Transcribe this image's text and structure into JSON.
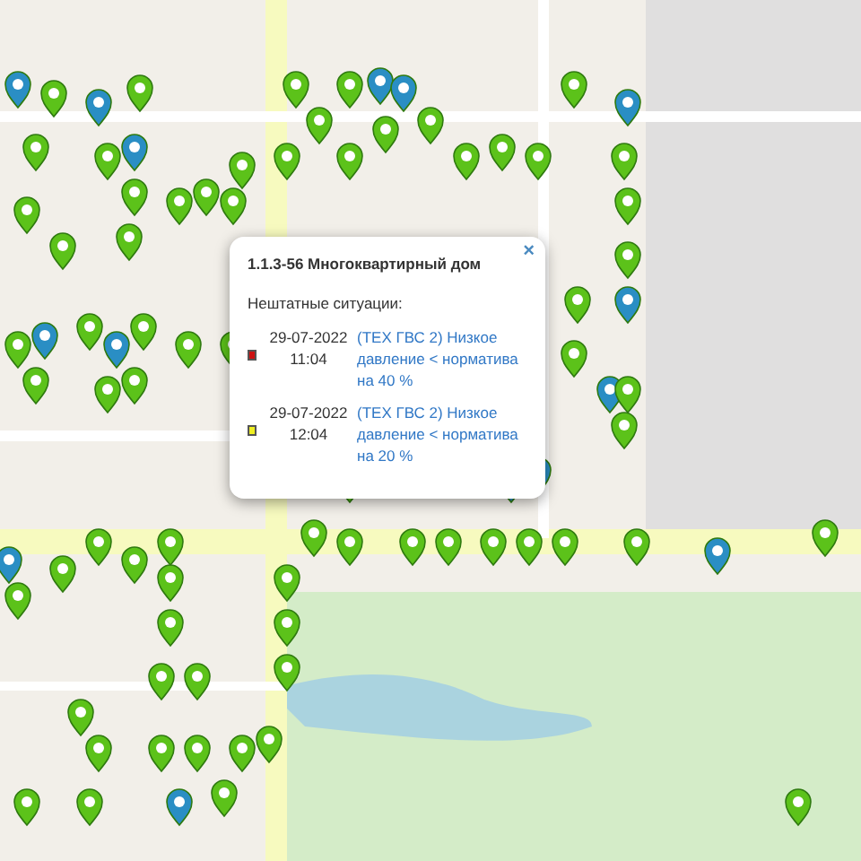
{
  "popup": {
    "title": "1.1.3-56 Многоквартирный дом",
    "close": "×",
    "section": "Нештатные ситуации:",
    "events": [
      {
        "color": "#cc1111",
        "date": "29-07-2022",
        "time": "11:04",
        "message": "(ТЕХ ГВС 2) Низкое давление < норматива на 40 %"
      },
      {
        "color": "#eeee22",
        "date": "29-07-2022",
        "time": "12:04",
        "message": "(ТЕХ ГВС 2) Низкое давление < норматива на 20 %"
      }
    ]
  }
}
